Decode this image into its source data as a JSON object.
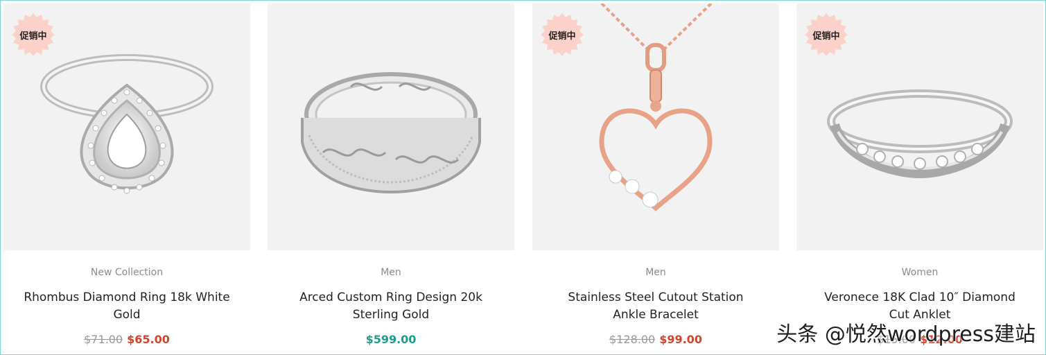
{
  "colors": {
    "frame_border": "#7fd3d9",
    "image_bg": "#f2f2f2",
    "badge_bg": "#fbd1c9",
    "sale_price": "#d0432c",
    "regular_price": "#1a9e8c",
    "old_price": "#999999",
    "category_text": "#8a8a8a"
  },
  "products": [
    {
      "badge": "促销中",
      "image_icon": "pear-diamond-halo-ring-icon",
      "category": "New Collection",
      "title": "Rhombus Diamond Ring 18k White Gold",
      "old_price": "$71.00",
      "price": "$65.00"
    },
    {
      "badge": "",
      "image_icon": "filigree-band-ring-icon",
      "category": "Men",
      "title": "Arced Custom Ring Design 20k Sterling Gold",
      "old_price": "",
      "price": "$599.00"
    },
    {
      "badge": "促销中",
      "image_icon": "rose-gold-heart-pendant-icon",
      "category": "Men",
      "title": "Stainless Steel Cutout Station Ankle Bracelet",
      "old_price": "$128.00",
      "price": "$99.00"
    },
    {
      "badge": "促销中",
      "image_icon": "diamond-wave-band-ring-icon",
      "category": "Women",
      "title": "Veronece 18K Clad 10″ Diamond Cut Anklet",
      "old_price": "$15.00",
      "price": "$12.00"
    }
  ],
  "watermark": "头条 @悦然wordpress建站"
}
